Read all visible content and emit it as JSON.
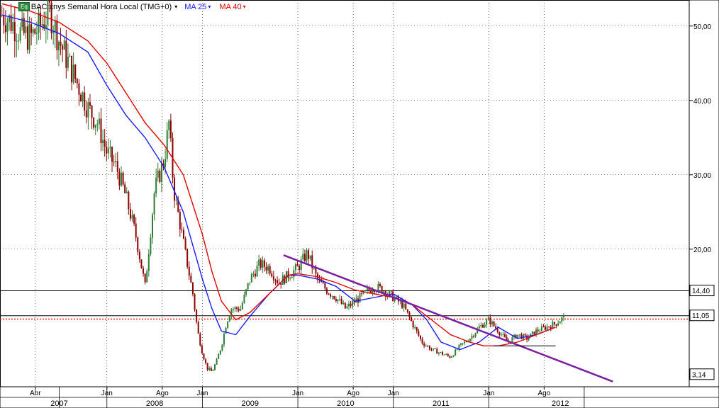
{
  "header": {
    "badge": "Eq",
    "symbol_label": "BAC:xnys Semanal Hora Local (TMG+0)",
    "ma25_label": "MA 25",
    "ma40_label": "MA 40",
    "dropdown_glyph": "▾"
  },
  "colors": {
    "price_up": "#2e7d32",
    "price_down": "#8b0000",
    "ma25": "#1a1aff",
    "ma40": "#e00000",
    "trendline": "#7b1fa2",
    "hline": "#000000",
    "dotted_line": "#e00000",
    "grid": "#000000"
  },
  "chart_data": {
    "type": "line",
    "title": "BAC:xnys Semanal Hora Local (TMG+0)",
    "y_axis": {
      "ticks": [
        "50,00",
        "40,00",
        "30,00",
        "20,00"
      ],
      "tick_values": [
        50,
        40,
        30,
        20
      ],
      "scale": "linear"
    },
    "price_markers": [
      {
        "label": "14,40",
        "value": 14.4
      },
      {
        "label": "11,05",
        "value": 11.05
      },
      {
        "label": "3,14",
        "value": 3.14
      }
    ],
    "x_axis": {
      "month_ticks": [
        "Abr",
        "Jan",
        "Ago",
        "Jan",
        "Jan",
        "Ago",
        "Jan",
        "Jan",
        "Ago"
      ],
      "month_dates": [
        2007.25,
        2008.0,
        2008.58,
        2009.0,
        2010.0,
        2010.58,
        2011.0,
        2012.0,
        2012.58
      ],
      "year_labels": [
        "2007",
        "2008",
        "2009",
        "2010",
        "2011",
        "2012"
      ],
      "year_dates": [
        2007.5,
        2008.5,
        2009.5,
        2010.5,
        2011.5,
        2012.75
      ]
    },
    "price": {
      "x": [
        2006.9,
        2007.0,
        2007.1,
        2007.2,
        2007.3,
        2007.4,
        2007.5,
        2007.6,
        2007.7,
        2007.8,
        2007.9,
        2008.0,
        2008.1,
        2008.2,
        2008.3,
        2008.4,
        2008.5,
        2008.6,
        2008.65,
        2008.7,
        2008.8,
        2008.9,
        2008.95,
        2009.0,
        2009.05,
        2009.1,
        2009.15,
        2009.2,
        2009.25,
        2009.3,
        2009.4,
        2009.5,
        2009.6,
        2009.7,
        2009.8,
        2009.9,
        2010.0,
        2010.1,
        2010.2,
        2010.3,
        2010.4,
        2010.5,
        2010.6,
        2010.7,
        2010.8,
        2010.9,
        2011.0,
        2011.1,
        2011.2,
        2011.3,
        2011.4,
        2011.5,
        2011.6,
        2011.7,
        2011.8,
        2011.9,
        2012.0,
        2012.1,
        2012.2,
        2012.3,
        2012.4,
        2012.5,
        2012.6,
        2012.7,
        2012.8
      ],
      "y": [
        51.5,
        50.5,
        49,
        48.5,
        50,
        52,
        48,
        45,
        42,
        39,
        37,
        33,
        31,
        27,
        22,
        15,
        28,
        32,
        37,
        28,
        21,
        14,
        9,
        6,
        4,
        3.5,
        5,
        7,
        10,
        12,
        12,
        16,
        18,
        17.5,
        15.5,
        16.5,
        17.5,
        19.5,
        16,
        14.5,
        13.5,
        12,
        13,
        14,
        15,
        14.5,
        13.5,
        12.5,
        10,
        7.5,
        6.5,
        6,
        5.5,
        7,
        8,
        9.5,
        10.5,
        9,
        7.5,
        8.5,
        8,
        9,
        9.5,
        10,
        11
      ]
    },
    "series": [
      {
        "name": "MA 25",
        "x": [
          2006.9,
          2007.2,
          2007.5,
          2007.8,
          2008.0,
          2008.2,
          2008.4,
          2008.6,
          2008.8,
          2009.0,
          2009.1,
          2009.2,
          2009.35,
          2009.5,
          2009.7,
          2009.9,
          2010.0,
          2010.2,
          2010.4,
          2010.6,
          2010.8,
          2011.0,
          2011.2,
          2011.35,
          2011.5,
          2011.7,
          2011.9,
          2012.1,
          2012.3,
          2012.5,
          2012.7
        ],
        "y": [
          51.5,
          50.5,
          49,
          46.5,
          42,
          38,
          35,
          31,
          25,
          16,
          12,
          9,
          8.5,
          11,
          14,
          16.5,
          16.5,
          16,
          15,
          13,
          13.5,
          14,
          12.5,
          10.5,
          7.5,
          6.5,
          7.5,
          9.5,
          8,
          8.5,
          9.5
        ]
      },
      {
        "name": "MA 40",
        "x": [
          2006.9,
          2007.2,
          2007.5,
          2007.8,
          2008.0,
          2008.2,
          2008.4,
          2008.6,
          2008.8,
          2009.0,
          2009.1,
          2009.2,
          2009.35,
          2009.5,
          2009.7,
          2009.9,
          2010.0,
          2010.2,
          2010.4,
          2010.6,
          2010.8,
          2011.0,
          2011.2,
          2011.4,
          2011.6,
          2011.8,
          2011.95,
          2012.1,
          2012.3,
          2012.5,
          2012.7
        ],
        "y": [
          53,
          52,
          50.5,
          48,
          45,
          41,
          37,
          34,
          30,
          22,
          17,
          13,
          10.5,
          11.5,
          14,
          16.5,
          16.7,
          16.3,
          15.5,
          14.5,
          14,
          13.5,
          12.5,
          10.5,
          8.5,
          7.5,
          7,
          7,
          7.5,
          8.5,
          9.5
        ]
      }
    ],
    "trendline": {
      "x": [
        2009.85,
        2013.3
      ],
      "y": [
        19.2,
        2.2
      ]
    },
    "support_line": {
      "x": [
        2012.05,
        2012.7
      ],
      "y": [
        7.0,
        7.0
      ]
    },
    "hlines": [
      14.4,
      11.05
    ],
    "dotted_line": 10.6,
    "ylim": [
      1.5,
      53.5
    ],
    "xlim": [
      2006.88,
      2014.1
    ],
    "grid": true,
    "legend": "top-left"
  }
}
